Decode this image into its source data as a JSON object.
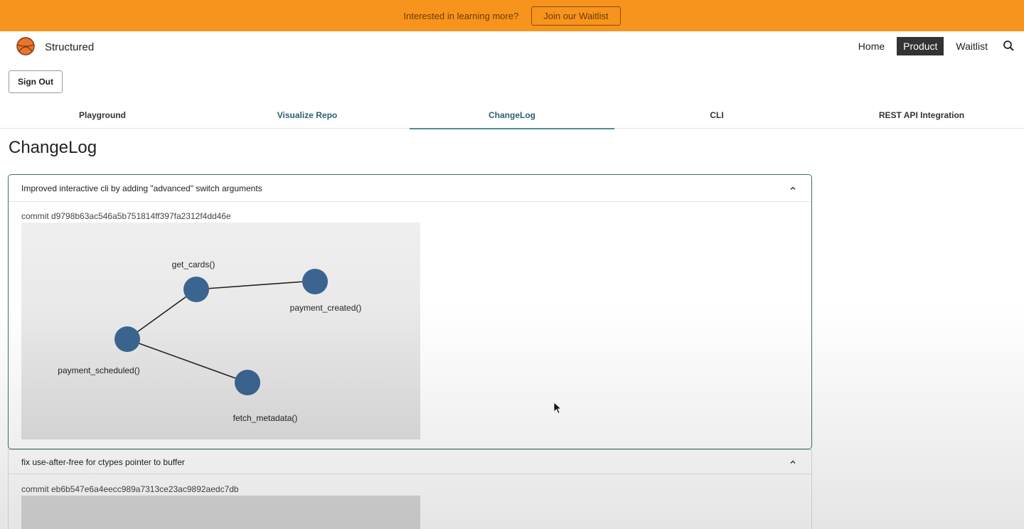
{
  "banner": {
    "text": "Interested in learning more?",
    "button_label": "Join our Waitlist",
    "color": "#f7941d"
  },
  "header": {
    "brand": "Structured",
    "nav": [
      "Home",
      "Product",
      "Waitlist"
    ],
    "active_nav": "Product"
  },
  "signout_label": "Sign Out",
  "tabs": [
    "Playground",
    "Visualize Repo",
    "ChangeLog",
    "CLI",
    "REST API Integration"
  ],
  "active_tab": "ChangeLog",
  "page_title": "ChangeLog",
  "changelog": [
    {
      "title": "Improved interactive cli by adding \"advanced\" switch arguments",
      "commit": "commit d9798b63ac546a5b751814ff397fa2312f4dd46e",
      "graph": {
        "nodes": [
          "get_cards()",
          "payment_created()",
          "payment_scheduled()",
          "fetch_metadata()"
        ],
        "edges": [
          [
            "get_cards()",
            "payment_created()"
          ],
          [
            "get_cards()",
            "payment_scheduled()"
          ],
          [
            "payment_scheduled()",
            "fetch_metadata()"
          ]
        ]
      }
    },
    {
      "title": "fix use-after-free for ctypes pointer to buffer",
      "commit": "commit eb6b547e6a4eecc989a7313ce23ac9892aedc7db"
    }
  ],
  "colors": {
    "accent": "#2a6171",
    "node": "#3b6590",
    "card_border": "#3d6e6e"
  }
}
